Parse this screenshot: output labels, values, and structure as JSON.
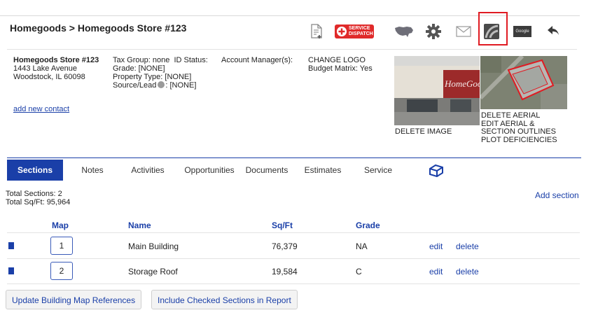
{
  "header": {
    "breadcrumb": "Homegoods > Homegoods Store #123",
    "toolbar_icons": [
      "document-add-icon",
      "service-dispatch-icon",
      "usa-map-icon",
      "gear-icon",
      "mail-icon",
      "aerial-icon",
      "google-icon",
      "back-arrow-icon"
    ],
    "service_badge_line1": "SERVICE",
    "service_badge_line2": "DISPATCH",
    "google_label": "Google"
  },
  "store": {
    "name": "Homegoods Store #123",
    "address1": "1443 Lake Avenue",
    "address2": "Woodstock, IL 60098",
    "add_contact": "add new contact"
  },
  "attributes": {
    "tax_group": "Tax Group: none",
    "id_status": "ID Status:",
    "grade": "Grade: [NONE]",
    "property_type": "Property Type: [NONE]",
    "source_lead_label": "Source/Lead",
    "source_lead_value": ": [NONE]"
  },
  "account": {
    "manager": "Account Manager(s):",
    "change_logo": "CHANGE LOGO",
    "budget_matrix": "Budget Matrix: Yes"
  },
  "images": {
    "storefront_sign": "HomeGoods",
    "delete_image": "DELETE IMAGE",
    "delete_aerial": "DELETE AERIAL",
    "edit_aerial_1": "EDIT AERIAL &",
    "edit_aerial_2": "SECTION OUTLINES",
    "plot_deficiencies": "PLOT DEFICIENCIES"
  },
  "tabs": [
    "Sections",
    "Notes",
    "Activities",
    "Opportunities",
    "Documents",
    "Estimates",
    "Service"
  ],
  "active_tab": "Sections",
  "summary": {
    "total_sections": "Total Sections: 2",
    "total_sqft": "Total Sq/Ft: 95,964",
    "add_section": "Add section"
  },
  "table": {
    "headers": {
      "map": "Map",
      "name": "Name",
      "sqft": "Sq/Ft",
      "grade": "Grade"
    },
    "rows": [
      {
        "map": "1",
        "name": "Main Building",
        "sqft": "76,379",
        "grade": "NA",
        "edit": "edit",
        "delete": "delete",
        "checked": true
      },
      {
        "map": "2",
        "name": "Storage Roof",
        "sqft": "19,584",
        "grade": "C",
        "edit": "edit",
        "delete": "delete",
        "checked": true
      }
    ]
  },
  "buttons": {
    "update_map": "Update Building Map References",
    "include_checked": "Include Checked Sections in Report"
  },
  "colors": {
    "accent": "#1a3fa8",
    "highlight": "#e01b22",
    "service_red": "#e02a2a"
  }
}
